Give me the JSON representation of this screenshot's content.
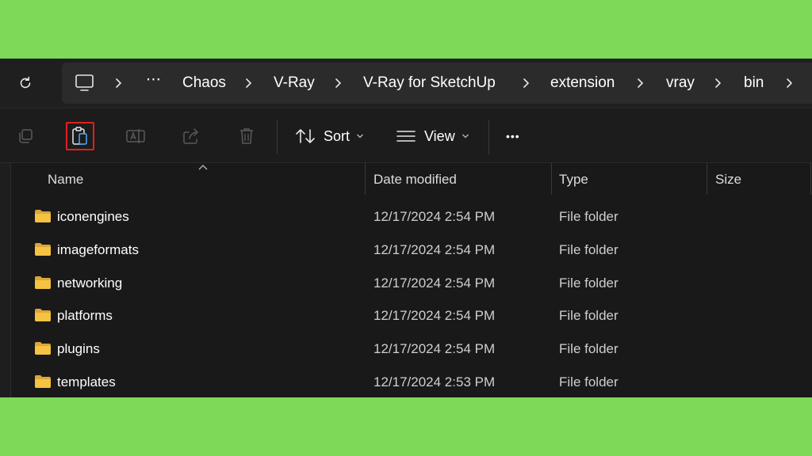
{
  "breadcrumb": {
    "items": [
      "Chaos",
      "V-Ray",
      "V-Ray for SketchUp",
      "extension",
      "vray",
      "bin"
    ],
    "overflow": "⋯"
  },
  "toolbar": {
    "sort_label": "Sort",
    "view_label": "View",
    "more_label": "•••"
  },
  "columns": {
    "name": "Name",
    "date": "Date modified",
    "type": "Type",
    "size": "Size"
  },
  "rows": [
    {
      "name": "iconengines",
      "date": "12/17/2024 2:54 PM",
      "type": "File folder"
    },
    {
      "name": "imageformats",
      "date": "12/17/2024 2:54 PM",
      "type": "File folder"
    },
    {
      "name": "networking",
      "date": "12/17/2024 2:54 PM",
      "type": "File folder"
    },
    {
      "name": "platforms",
      "date": "12/17/2024 2:54 PM",
      "type": "File folder"
    },
    {
      "name": "plugins",
      "date": "12/17/2024 2:54 PM",
      "type": "File folder"
    },
    {
      "name": "templates",
      "date": "12/17/2024 2:53 PM",
      "type": "File folder"
    }
  ],
  "colors": {
    "background": "#7dd957",
    "window": "#191919",
    "folder": "#f5c242",
    "highlight": "#e02020"
  }
}
